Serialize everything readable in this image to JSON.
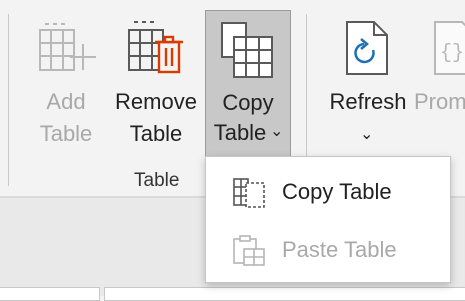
{
  "ribbon": {
    "group_label": "Table",
    "buttons": {
      "add_table": {
        "line1": "Add",
        "line2": "Table",
        "enabled": false
      },
      "remove_table": {
        "line1": "Remove",
        "line2": "Table",
        "enabled": true
      },
      "copy_table": {
        "line1": "Copy",
        "line2": "Table",
        "chevron": "⌄",
        "enabled": true,
        "pressed": true
      },
      "refresh": {
        "line1": "Refresh",
        "chevron": "⌄",
        "enabled": true
      },
      "promote": {
        "line1": "Prom",
        "enabled": false
      }
    },
    "icons": {
      "add_table": "table-add-icon",
      "remove_table": "table-delete-icon",
      "copy_table": "table-copy-icon",
      "refresh": "document-refresh-icon",
      "promote": "document-code-icon"
    }
  },
  "dropdown_menu": {
    "items": [
      {
        "label": "Copy Table",
        "icon": "copy-table-icon",
        "enabled": true
      },
      {
        "label": "Paste Table",
        "icon": "paste-table-icon",
        "enabled": false
      }
    ]
  },
  "colors": {
    "ribbon_bg": "#f3f3f3",
    "pressed_bg": "#c8c8c8",
    "delete_red": "#d83b01",
    "refresh_blue": "#1e6fb5",
    "disabled_text": "#a8a8a8"
  }
}
